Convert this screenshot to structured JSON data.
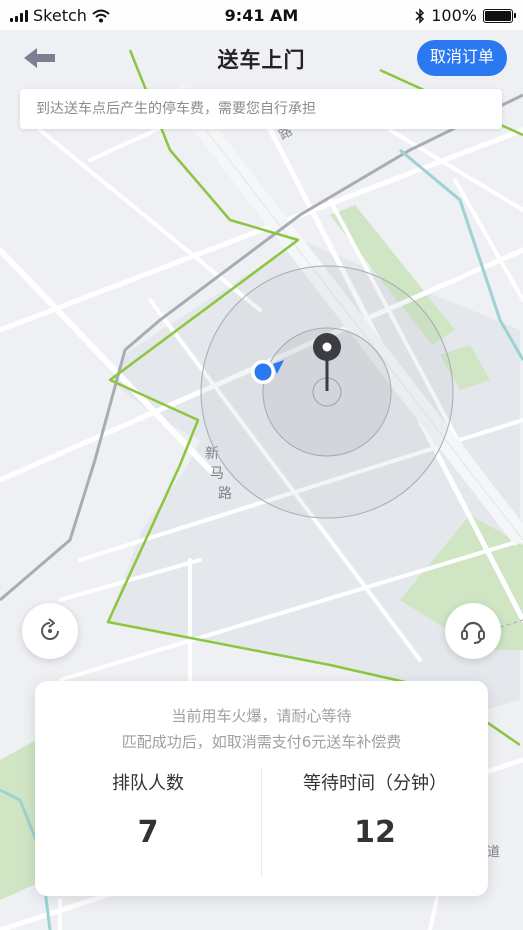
{
  "status_bar": {
    "carrier": "Sketch",
    "time": "9:41 AM",
    "battery": "100%",
    "battery_level": 1.0
  },
  "header": {
    "title": "送车上门",
    "cancel_label": "取消订单",
    "back_icon": "back-arrow-icon"
  },
  "notice": {
    "text": "到达送车点后产生的停车费，需要您自行承担"
  },
  "map": {
    "street_labels": [
      "路",
      "新",
      "马",
      "路",
      "道"
    ],
    "colors": {
      "background": "#eef0f3",
      "road": "#ffffff",
      "boundary": "#8cc63f",
      "park": "#cfe5c3",
      "highway": "#a9adb3",
      "current_location": "#2b79f0",
      "pin": "#3b3d42"
    },
    "icons": {
      "current_location": "current-location-icon",
      "destination_pin": "map-pin-icon"
    }
  },
  "buttons": {
    "refresh_icon": "refresh-icon",
    "service_icon": "headset-icon"
  },
  "card": {
    "line1": "当前用车火爆，请耐心等待",
    "line2": "匹配成功后，如取消需支付6元送车补偿费",
    "queue_label": "排队人数",
    "queue_value": "7",
    "wait_label": "等待时间（分钟）",
    "wait_value": "12"
  },
  "colors": {
    "accent": "#2b79f0",
    "text_primary": "#333333",
    "text_secondary": "#a0a0a0"
  }
}
